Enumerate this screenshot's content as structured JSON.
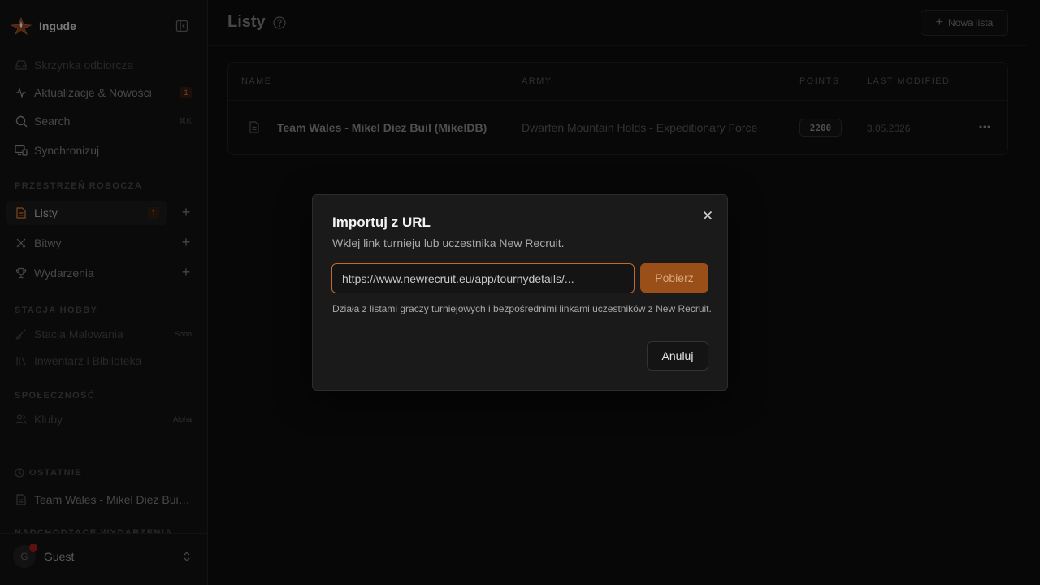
{
  "app": {
    "name": "Ingude"
  },
  "sidebar": {
    "top_items": [
      {
        "label": "Skrzynka odbiorcza",
        "icon": "inbox-icon"
      },
      {
        "label": "Aktualizacje & Nowości",
        "icon": "activity-icon",
        "badge": "1"
      },
      {
        "label": "Search",
        "icon": "search-icon",
        "shortcut": "⌘K"
      },
      {
        "label": "Synchronizuj",
        "icon": "devices-icon"
      }
    ],
    "workspace_section": "PRZESTRZEŃ ROBOCZA",
    "workspace_items": [
      {
        "label": "Listy",
        "icon": "file-icon",
        "badge": "1"
      },
      {
        "label": "Bitwy",
        "icon": "swords-icon"
      },
      {
        "label": "Wydarzenia",
        "icon": "trophy-icon"
      }
    ],
    "hobby_section": "STACJA HOBBY",
    "hobby_items": [
      {
        "label": "Stacja Malowania",
        "icon": "brush-icon",
        "tag": "Soon"
      },
      {
        "label": "Inwentarz i Biblioteka",
        "icon": "library-icon"
      }
    ],
    "community_section": "SPOŁECZNOŚĆ",
    "community_items": [
      {
        "label": "Kluby",
        "icon": "users-icon",
        "tag": "Alpha"
      }
    ],
    "recent_section": "OSTATNIE",
    "recent_items": [
      {
        "label": "Team Wales - Mikel Diez Buil (MikelDB)",
        "icon": "file-icon"
      }
    ],
    "upcoming_section": "NADCHODZĄCE WYDARZENIA",
    "user": {
      "initial": "G",
      "name": "Guest"
    }
  },
  "header": {
    "title": "Listy",
    "new_list_label": "Nowa lista"
  },
  "table": {
    "columns": [
      "NAME",
      "ARMY",
      "POINTS",
      "LAST MODIFIED"
    ],
    "rows": [
      {
        "name": "Team Wales - Mikel Diez Buil (MikelDB)",
        "army": "Dwarfen Mountain Holds - Expeditionary Force",
        "points": "2200",
        "last_modified": "3.05.2026"
      }
    ]
  },
  "dialog": {
    "title": "Importuj z URL",
    "subtitle": "Wklej link turnieju lub uczestnika New Recruit.",
    "url_value": "https://www.newrecruit.eu/app/tournydetails/...",
    "fetch_label": "Pobierz",
    "help_text": "Działa z listami graczy turniejowych i bezpośrednimi linkami uczestników z New Recruit.",
    "cancel_label": "Anuluj"
  },
  "colors": {
    "accent": "#c36a27",
    "accent_button": "#9a4f18",
    "notification_dot": "#8e1a1a"
  }
}
